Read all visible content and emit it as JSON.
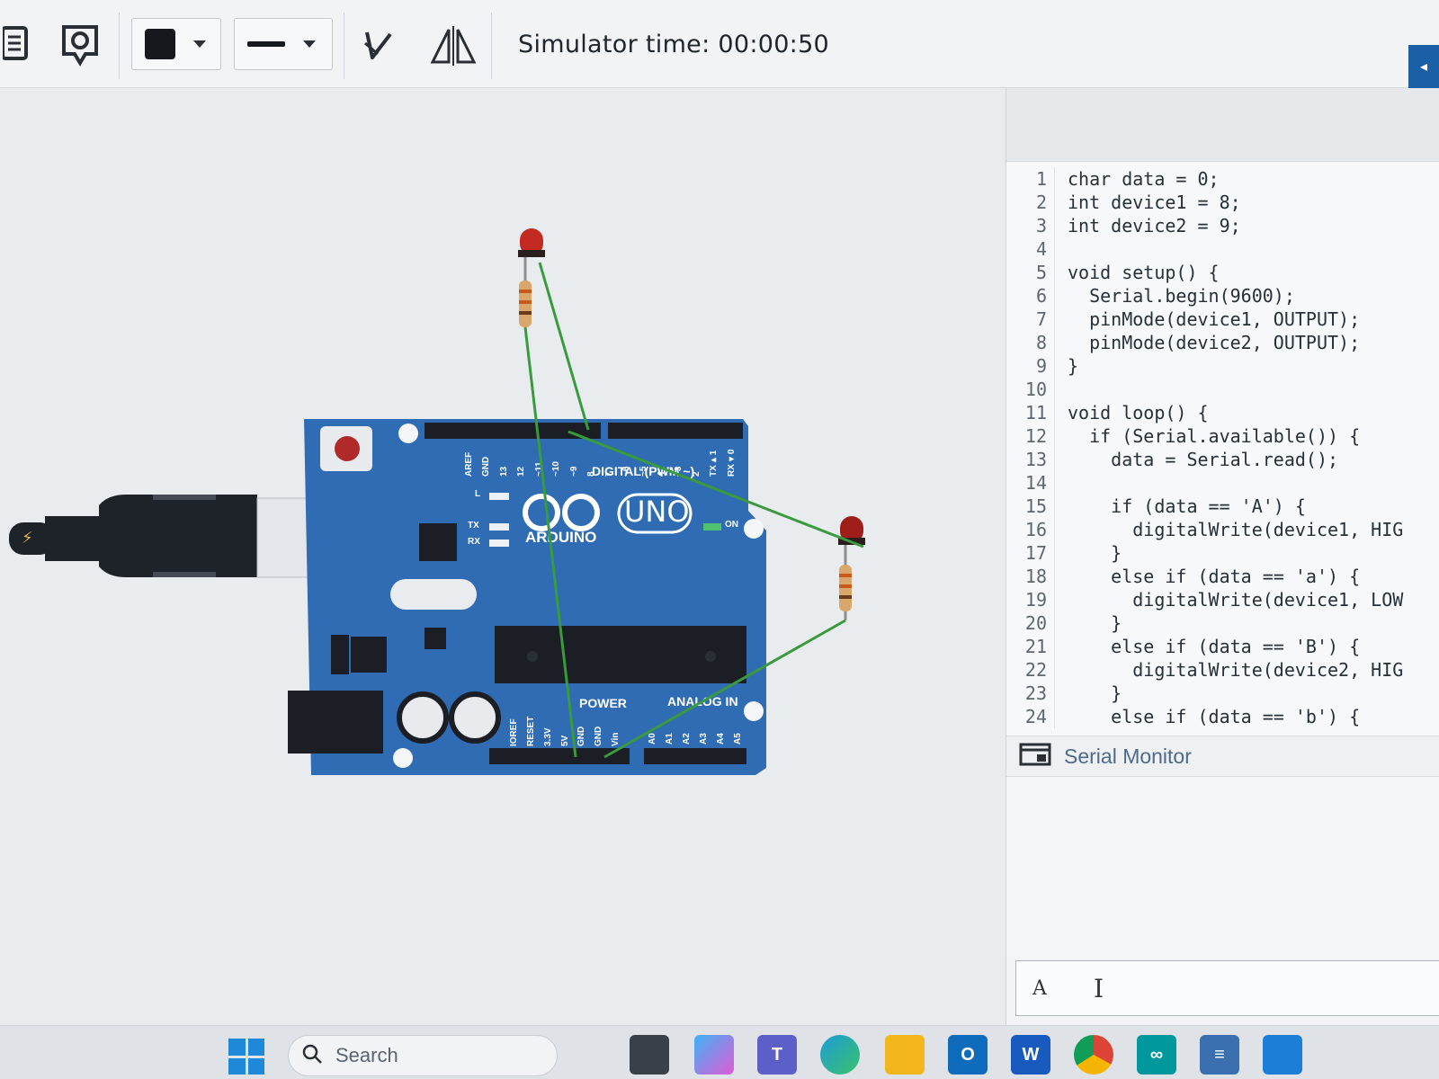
{
  "toolbar": {
    "simulator_time": "Simulator time: 00:00:50",
    "icons": [
      "notes-icon",
      "component-icon",
      "color-swatch-icon",
      "line-style-icon",
      "rotate-icon",
      "flip-icon",
      "collapse-panel-icon"
    ]
  },
  "board": {
    "brand": "ARDUINO",
    "model": "UNO",
    "digital_label": "DIGITAL (PWM ~)",
    "power_label": "POWER",
    "analog_label": "ANALOG IN",
    "on_label": "ON",
    "tx_label": "TX",
    "rx_label": "RX",
    "l_label": "L",
    "top_pins": [
      "AREF",
      "GND",
      "13",
      "12",
      "~11",
      "~10",
      "~9",
      "8",
      "7",
      "~6",
      "~5",
      "4",
      "~3",
      "2",
      "TX▸1",
      "RX◂0"
    ],
    "power_pins": [
      "IOREF",
      "RESET",
      "3.3V",
      "5V",
      "GND",
      "GND",
      "Vin"
    ],
    "analog_pins": [
      "A0",
      "A1",
      "A2",
      "A3",
      "A4",
      "A5"
    ]
  },
  "code": {
    "lines": [
      {
        "n": "1",
        "text": "char data = 0;"
      },
      {
        "n": "2",
        "text": "int device1 = 8;"
      },
      {
        "n": "3",
        "text": "int device2 = 9;"
      },
      {
        "n": "4",
        "text": ""
      },
      {
        "n": "5",
        "text": "void setup() {"
      },
      {
        "n": "6",
        "text": "  Serial.begin(9600);"
      },
      {
        "n": "7",
        "text": "  pinMode(device1, OUTPUT);"
      },
      {
        "n": "8",
        "text": "  pinMode(device2, OUTPUT);"
      },
      {
        "n": "9",
        "text": "}"
      },
      {
        "n": "10",
        "text": ""
      },
      {
        "n": "11",
        "text": "void loop() {"
      },
      {
        "n": "12",
        "text": "  if (Serial.available()) {"
      },
      {
        "n": "13",
        "text": "    data = Serial.read();"
      },
      {
        "n": "14",
        "text": ""
      },
      {
        "n": "15",
        "text": "    if (data == 'A') {"
      },
      {
        "n": "16",
        "text": "      digitalWrite(device1, HIG"
      },
      {
        "n": "17",
        "text": "    }"
      },
      {
        "n": "18",
        "text": "    else if (data == 'a') {"
      },
      {
        "n": "19",
        "text": "      digitalWrite(device1, LOW"
      },
      {
        "n": "20",
        "text": "    }"
      },
      {
        "n": "21",
        "text": "    else if (data == 'B') {"
      },
      {
        "n": "22",
        "text": "      digitalWrite(device2, HIG"
      },
      {
        "n": "23",
        "text": "    }"
      },
      {
        "n": "24",
        "text": "    else if (data == 'b') {"
      }
    ]
  },
  "serial_monitor": {
    "title": "Serial Monitor",
    "input_value": "A"
  },
  "taskbar": {
    "search_label": "Search",
    "apps": [
      "files-icon",
      "copilot-icon",
      "teams-icon",
      "edge-icon",
      "file-explorer-icon",
      "outlook-icon",
      "word-icon",
      "chrome-icon",
      "arduino-icon",
      "notepad-icon",
      "photos-icon"
    ]
  }
}
